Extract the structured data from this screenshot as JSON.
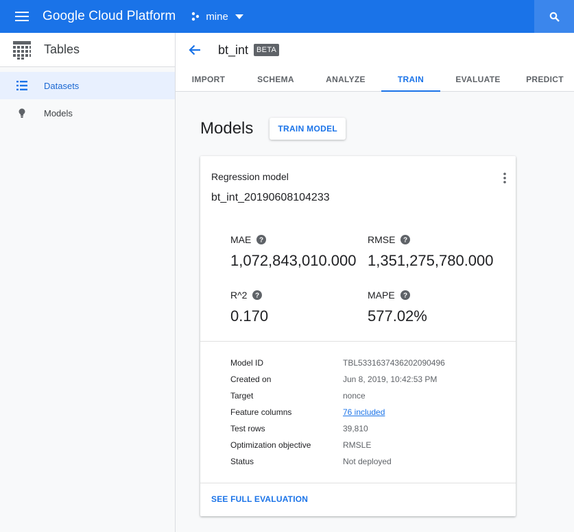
{
  "topbar": {
    "brand": "Google Cloud Platform",
    "project": "mine",
    "icons": {
      "menu": "menu-icon",
      "project": "project-dots-icon",
      "dropdown": "caret-down-icon",
      "search": "search-icon"
    }
  },
  "sidebar": {
    "title": "Tables",
    "items": [
      {
        "label": "Datasets",
        "icon": "list-icon",
        "active": true
      },
      {
        "label": "Models",
        "icon": "lightbulb-icon",
        "active": false
      }
    ]
  },
  "header": {
    "dataset_name": "bt_int",
    "badge": "BETA"
  },
  "tabs": [
    {
      "label": "IMPORT",
      "active": false
    },
    {
      "label": "SCHEMA",
      "active": false
    },
    {
      "label": "ANALYZE",
      "active": false
    },
    {
      "label": "TRAIN",
      "active": true
    },
    {
      "label": "EVALUATE",
      "active": false
    },
    {
      "label": "PREDICT",
      "active": false
    }
  ],
  "models": {
    "title": "Models",
    "train_button": "TRAIN MODEL",
    "card": {
      "type": "Regression model",
      "name": "bt_int_20190608104233",
      "metrics": [
        {
          "label": "MAE",
          "value": "1,072,843,010.000"
        },
        {
          "label": "RMSE",
          "value": "1,351,275,780.000"
        },
        {
          "label": "R^2",
          "value": "0.170"
        },
        {
          "label": "MAPE",
          "value": "577.02%"
        }
      ],
      "details": [
        {
          "key": "Model ID",
          "value": "TBL5331637436202090496"
        },
        {
          "key": "Created on",
          "value": "Jun 8, 2019, 10:42:53 PM"
        },
        {
          "key": "Target",
          "value": "nonce"
        },
        {
          "key": "Feature columns",
          "value": "76 included"
        },
        {
          "key": "Test rows",
          "value": "39,810"
        },
        {
          "key": "Optimization objective",
          "value": "RMSLE"
        },
        {
          "key": "Status",
          "value": "Not deployed"
        }
      ],
      "footer_link": "SEE FULL EVALUATION"
    }
  },
  "colors": {
    "accent": "#1a73e8",
    "topbar": "#1a73e8",
    "sidebar_active_bg": "#e8f0fe"
  }
}
